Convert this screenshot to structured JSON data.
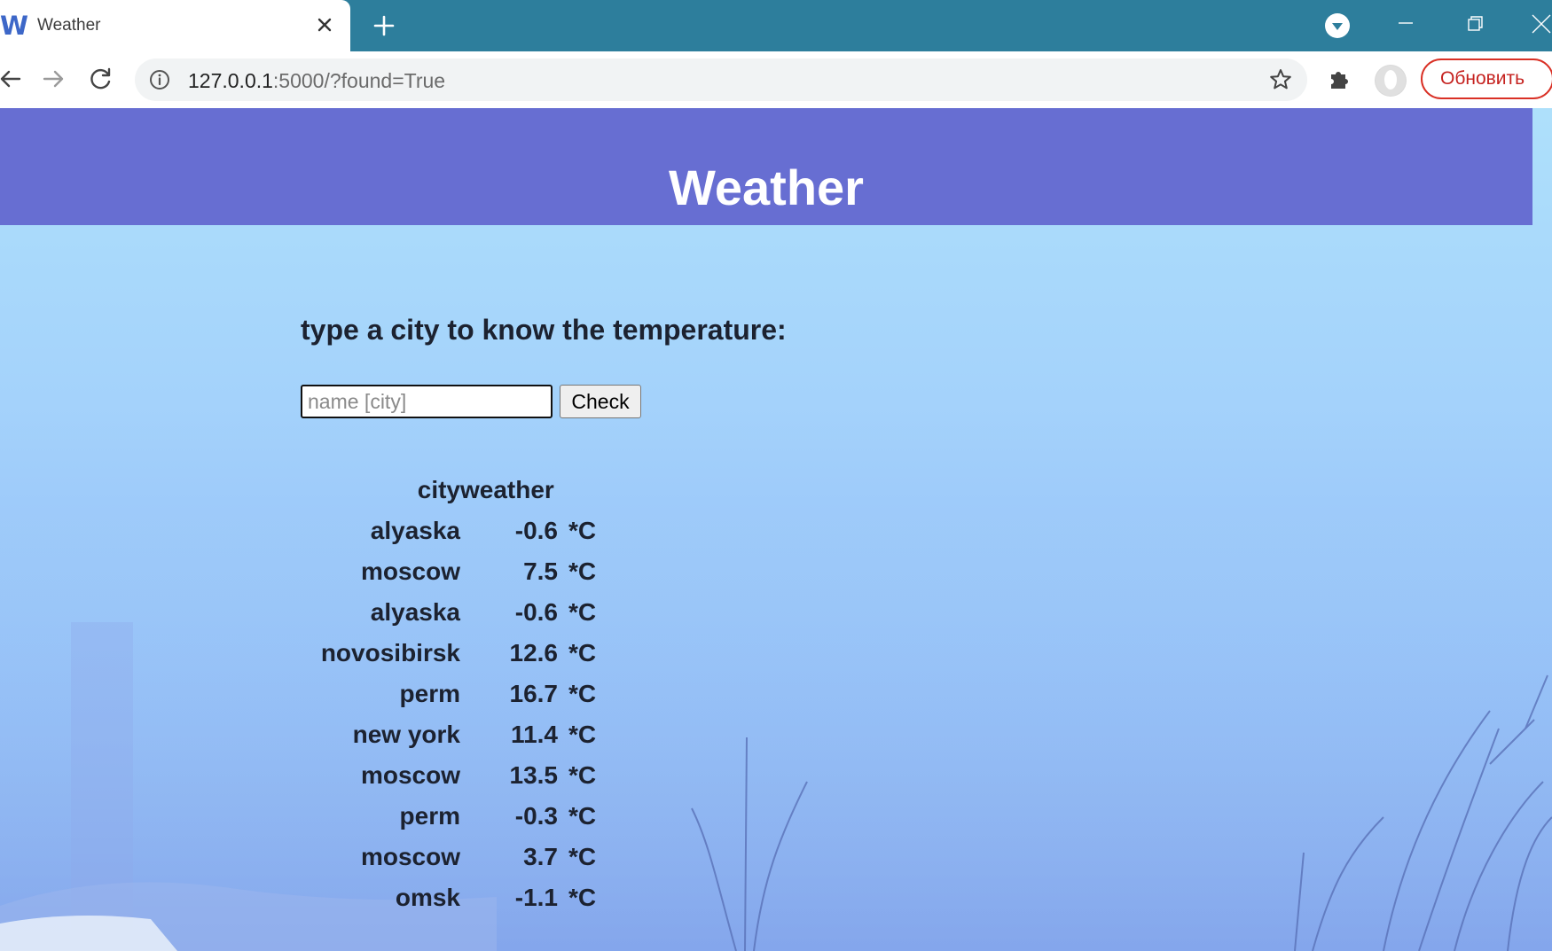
{
  "browser": {
    "tab": {
      "favicon": "W",
      "title": "Weather"
    },
    "address": {
      "host": "127.0.0.1",
      "rest": ":5000/?found=True"
    },
    "update_button": "Обновить"
  },
  "page": {
    "header_title": "Weather",
    "prompt": "type a city to know the temperature:",
    "input": {
      "placeholder": "name [city]",
      "value": ""
    },
    "check_button": "Check",
    "table": {
      "headers": {
        "city": "city",
        "weather": "weather"
      },
      "rows": [
        {
          "city": "alyaska",
          "temp": "-0.6",
          "unit": "*C"
        },
        {
          "city": "moscow",
          "temp": "7.5",
          "unit": "*C"
        },
        {
          "city": "alyaska",
          "temp": "-0.6",
          "unit": "*C"
        },
        {
          "city": "novosibirsk",
          "temp": "12.6",
          "unit": "*C"
        },
        {
          "city": "perm",
          "temp": "16.7",
          "unit": "*C"
        },
        {
          "city": "new york",
          "temp": "11.4",
          "unit": "*C"
        },
        {
          "city": "moscow",
          "temp": "13.5",
          "unit": "*C"
        },
        {
          "city": "perm",
          "temp": "-0.3",
          "unit": "*C"
        },
        {
          "city": "moscow",
          "temp": "3.7",
          "unit": "*C"
        },
        {
          "city": "omsk",
          "temp": "-1.1",
          "unit": "*C"
        }
      ]
    }
  },
  "colors": {
    "tabbar": "#2d7e9c",
    "header_band": "#676ed2",
    "background_top": "#aee0fb",
    "background_bottom": "#8aaef0",
    "update_button": "#d93025"
  },
  "icons": {
    "tab_close": "close-icon",
    "new_tab": "plus-icon",
    "tab_search": "chevron-down-circle-icon",
    "minimize": "minimize-icon",
    "maximize": "restore-icon",
    "close": "close-icon",
    "back": "arrow-left-icon",
    "forward": "arrow-right-icon",
    "reload": "reload-icon",
    "site_info": "info-icon",
    "bookmark": "star-icon",
    "extensions": "puzzle-icon",
    "profile": "avatar-icon"
  }
}
